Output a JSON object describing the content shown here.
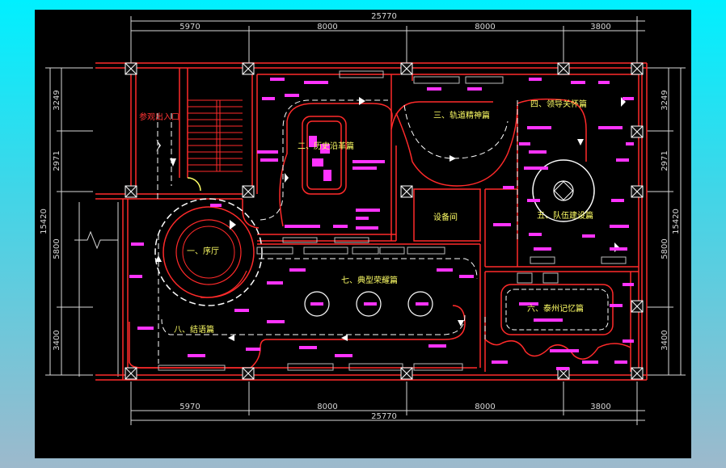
{
  "dimensions": {
    "total_width": "25770",
    "segments": [
      "5970",
      "8000",
      "8000",
      "3800"
    ],
    "total_height": "15420",
    "left_segments": [
      "3249",
      "2971",
      "5800",
      "3400"
    ],
    "right_segments": [
      "3249",
      "2971",
      "5800",
      "3400"
    ]
  },
  "rooms": {
    "r1": "一、序厅",
    "r2": "二、历史沿革篇",
    "r3": "三、轨道精神篇",
    "r4": "四、领导关怀篇",
    "r5": "五、队伍建设篇",
    "r6": "六、泰州记忆篇",
    "r7": "七、典型荣耀篇",
    "r8": "八、结语篇",
    "equipment": "设备间",
    "entrance": "参观出入口"
  },
  "colors": {
    "wall": "#ff2a2a",
    "dimension": "#d8d8d8",
    "label": "#ffff66",
    "annotation": "#ff33ff",
    "flow": "#ffffff"
  }
}
